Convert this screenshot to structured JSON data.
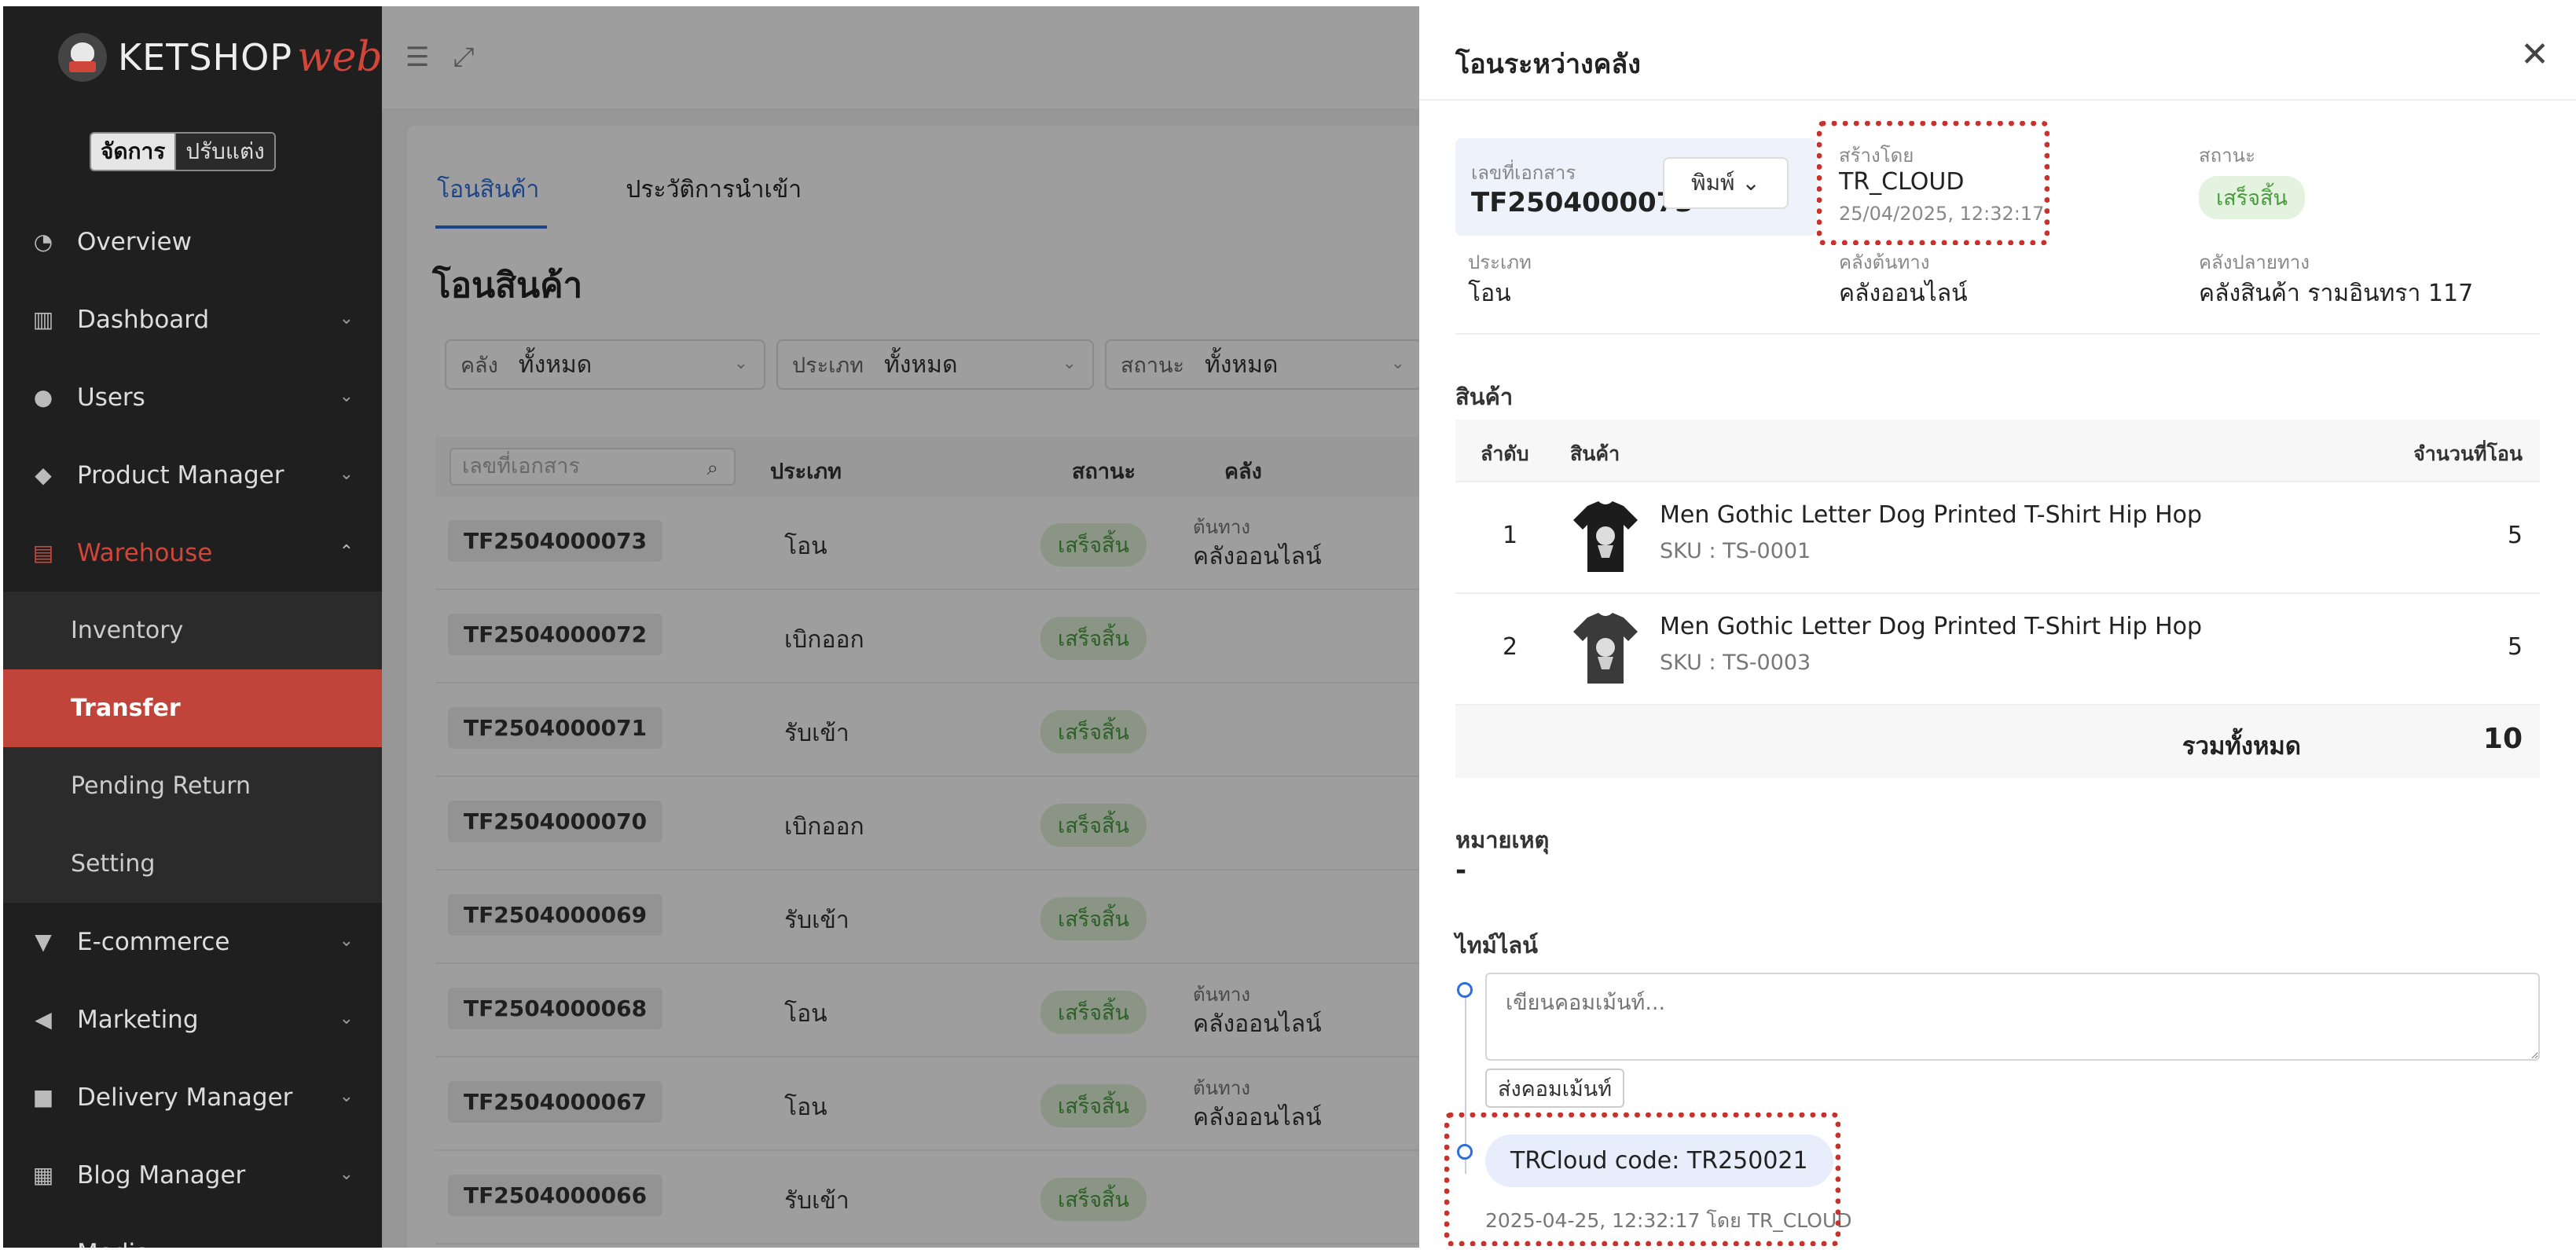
{
  "sidebar": {
    "logo_text": "KETSHOP",
    "logo_web": "web",
    "mode_manage": "จัดการ",
    "mode_customize": "ปรับแต่ง",
    "items": [
      {
        "label": "Overview",
        "icon": "pie-chart-icon"
      },
      {
        "label": "Dashboard",
        "icon": "bar-chart-icon"
      },
      {
        "label": "Users",
        "icon": "users-icon"
      },
      {
        "label": "Product Manager",
        "icon": "tag-icon"
      },
      {
        "label": "Warehouse",
        "icon": "warehouse-icon"
      },
      {
        "label": "E-commerce",
        "icon": "cart-icon"
      },
      {
        "label": "Marketing",
        "icon": "megaphone-icon"
      },
      {
        "label": "Delivery Manager",
        "icon": "truck-icon"
      },
      {
        "label": "Blog Manager",
        "icon": "blog-icon"
      },
      {
        "label": "Media",
        "icon": "folder-icon"
      }
    ],
    "warehouse_sub": [
      "Inventory",
      "Transfer",
      "Pending Return",
      "Setting"
    ],
    "accent_color": "#c0443a"
  },
  "main": {
    "tabs": [
      "โอนสินค้า",
      "ประวัติการนำเข้า"
    ],
    "title": "โอนสินค้า",
    "filters": [
      {
        "label": "คลัง",
        "value": "ทั้งหมด"
      },
      {
        "label": "ประเภท",
        "value": "ทั้งหมด"
      },
      {
        "label": "สถานะ",
        "value": "ทั้งหมด"
      }
    ],
    "search_placeholder": "เลขที่เอกสาร",
    "columns": [
      "ประเภท",
      "สถานะ",
      "คลัง"
    ],
    "rows": [
      {
        "doc": "TF2504000073",
        "type": "โอน",
        "status": "เสร็จสิ้น",
        "src_label": "ต้นทาง",
        "src": "คลังออนไลน์"
      },
      {
        "doc": "TF2504000072",
        "type": "เบิกออก",
        "status": "เสร็จสิ้น",
        "src_label": "",
        "src": ""
      },
      {
        "doc": "TF2504000071",
        "type": "รับเข้า",
        "status": "เสร็จสิ้น",
        "src_label": "",
        "src": ""
      },
      {
        "doc": "TF2504000070",
        "type": "เบิกออก",
        "status": "เสร็จสิ้น",
        "src_label": "",
        "src": ""
      },
      {
        "doc": "TF2504000069",
        "type": "รับเข้า",
        "status": "เสร็จสิ้น",
        "src_label": "",
        "src": ""
      },
      {
        "doc": "TF2504000068",
        "type": "โอน",
        "status": "เสร็จสิ้น",
        "src_label": "ต้นทาง",
        "src": "คลังออนไลน์"
      },
      {
        "doc": "TF2504000067",
        "type": "โอน",
        "status": "เสร็จสิ้น",
        "src_label": "ต้นทาง",
        "src": "คลังออนไลน์"
      },
      {
        "doc": "TF2504000066",
        "type": "รับเข้า",
        "status": "เสร็จสิ้น",
        "src_label": "",
        "src": ""
      }
    ]
  },
  "drawer": {
    "title": "โอนระหว่างคลัง",
    "doc_label": "เลขที่เอกสาร",
    "doc_no": "TF2504000073",
    "print_label": "พิมพ์",
    "created_by_label": "สร้างโดย",
    "created_by": "TR_CLOUD",
    "created_at": "25/04/2025, 12:32:17",
    "status_label": "สถานะ",
    "status": "เสร็จสิ้น",
    "type_label": "ประเภท",
    "type": "โอน",
    "src_label": "คลังต้นทาง",
    "src": "คลังออนไลน์",
    "dst_label": "คลังปลายทาง",
    "dst": "คลังสินค้า รามอินทรา 117",
    "products_title": "สินค้า",
    "col_index": "ลำดับ",
    "col_product": "สินค้า",
    "col_qty": "จำนวนที่โอน",
    "products": [
      {
        "index": "1",
        "name": "Men Gothic Letter Dog Printed T-Shirt Hip Hop",
        "sku": "SKU : TS-0001",
        "qty": "5"
      },
      {
        "index": "2",
        "name": "Men Gothic Letter Dog Printed T-Shirt Hip Hop",
        "sku": "SKU : TS-0003",
        "qty": "5"
      }
    ],
    "total_label": "รวมทั้งหมด",
    "total": "10",
    "note_title": "หมายเหตุ",
    "note": "-",
    "timeline_title": "ไทม์ไลน์",
    "comment_placeholder": "เขียนคอมเม้นท์...",
    "send_label": "ส่งคอมเม้นท์",
    "timeline_message": "TRCloud code: TR250021",
    "timeline_meta": "2025-04-25, 12:32:17 โดย TR_CLOUD",
    "highlight_color": "#c8322d"
  }
}
